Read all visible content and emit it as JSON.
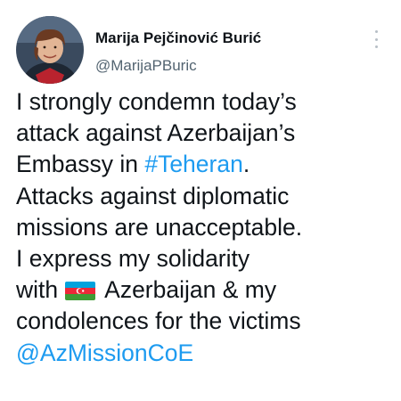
{
  "author": {
    "display_name": "Marija Pejčinović Burić",
    "handle": "@MarijaPBuric"
  },
  "menu": {
    "icon": "more-vertical-icon"
  },
  "tweet": {
    "line1": "I strongly condemn today’s",
    "line2": "attack against Azerbaijan’s",
    "line3_before": "Embassy in ",
    "hashtag": "#Teheran",
    "line3_after": ".",
    "line4": "Attacks against diplomatic",
    "line5": "missions are unacceptable.",
    "line6": "I express my solidarity",
    "line7_before": "with",
    "flag_icon": "azerbaijan-flag-icon",
    "line7_after": "Azerbaijan & my",
    "line8": "condolences for the victims",
    "mention": "@AzMissionCoE"
  },
  "colors": {
    "link": "#1d9bf0",
    "text": "#0f1419",
    "handle": "#536471"
  }
}
